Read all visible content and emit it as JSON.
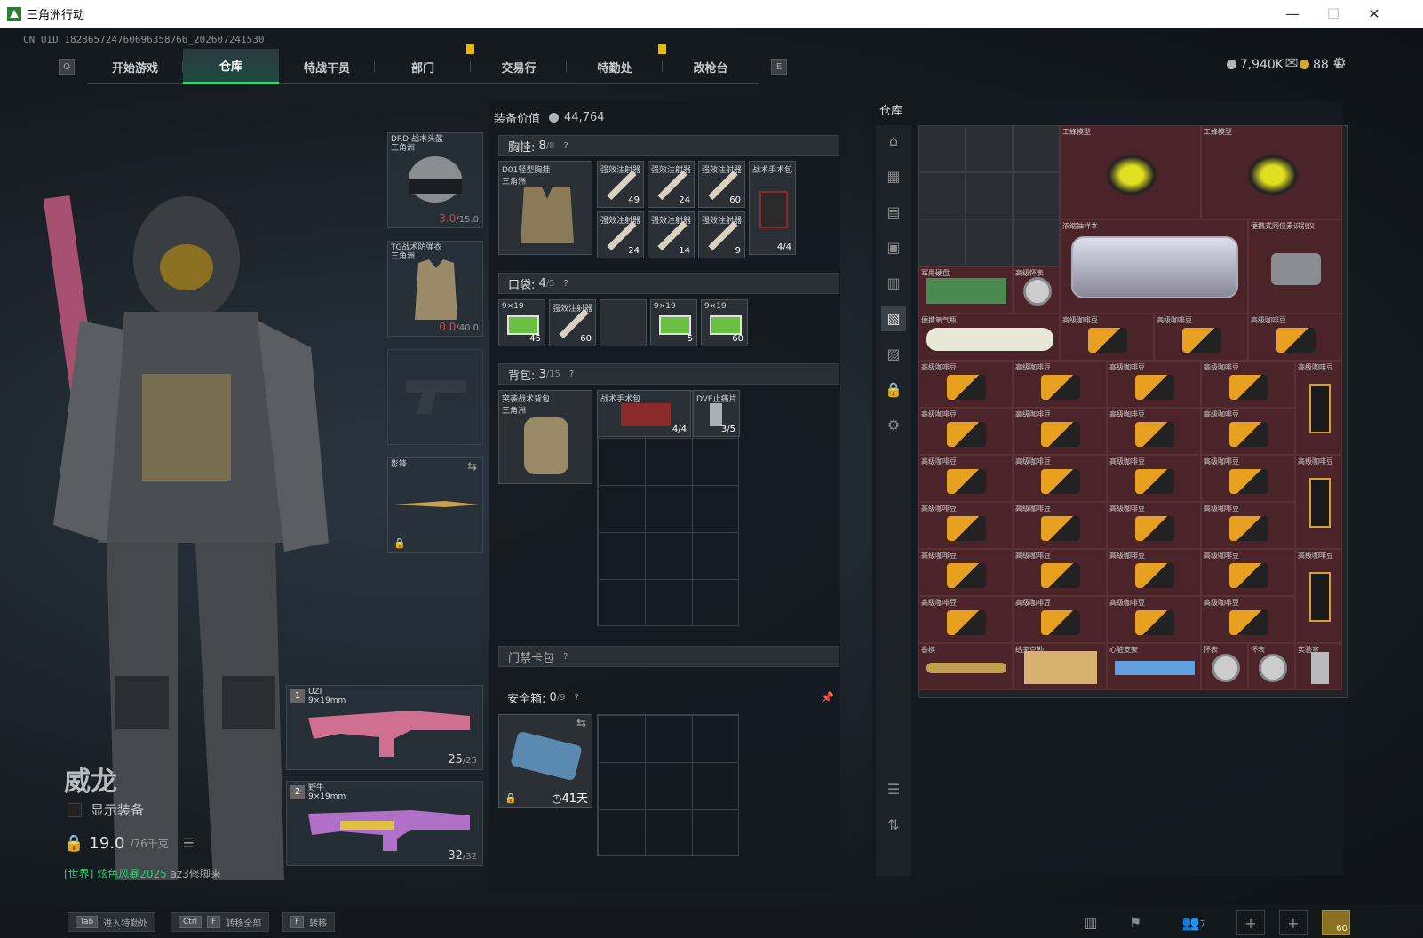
{
  "window": {
    "title": "三角洲行动",
    "minimize": "—",
    "maximize": "☐",
    "close": "✕"
  },
  "uid": "CN UID 18236572476069635876­6_202607241530",
  "nav": {
    "key_left": "Q",
    "key_right": "E",
    "tabs": [
      "开始游戏",
      "仓库",
      "特战干员",
      "部门",
      "交易行",
      "特勤处",
      "改枪台"
    ],
    "active": "仓库"
  },
  "currency": {
    "silver": "7,940K",
    "gold": "88",
    "plus": "+"
  },
  "operator": {
    "name": "威龙",
    "show_equipment": "显示装备",
    "weight": "19.0",
    "weight_max": "/76千克"
  },
  "chat": {
    "channel": "[世界]",
    "user": "炫色风暴2025",
    "message": "az3修脚来"
  },
  "gear": {
    "helmet": {
      "name": "DRD 战术头盔",
      "sub": "三角洲",
      "dur": "3.0",
      "max": "/15.0"
    },
    "armor": {
      "name": "TG战术防弹衣",
      "sub": "三角洲",
      "dur": "0.0",
      "max": "/40.0"
    },
    "melee": {
      "name": "影锋"
    }
  },
  "weapons": [
    {
      "num": "1",
      "name": "UZI",
      "sub": "9×19mm",
      "ammo": "25",
      "ammo_max": "/25"
    },
    {
      "num": "2",
      "name": "野牛",
      "sub": "9×19mm",
      "ammo": "32",
      "ammo_max": "/32"
    }
  ],
  "loadout": {
    "value_label": "装备价值",
    "value": "44,764",
    "chest": {
      "label": "胸挂:",
      "count": "8",
      "cap": "/8",
      "q": "?"
    },
    "chest_item": {
      "name": "D01轻型胸挂",
      "sub": "三角洲"
    },
    "chest_cells": [
      {
        "name": "强效注射器",
        "count": "49"
      },
      {
        "name": "强效注射器",
        "count": "24"
      },
      {
        "name": "强效注射器",
        "count": "60"
      },
      {
        "name": "战术手术包",
        "count": "4/4"
      },
      {
        "name": "强效注射器",
        "count": "24"
      },
      {
        "name": "强效注射器",
        "count": "14"
      },
      {
        "name": "强效注射器",
        "count": "9"
      }
    ],
    "pocket": {
      "label": "口袋:",
      "count": "4",
      "cap": "/5",
      "q": "?"
    },
    "pocket_cells": [
      {
        "name": "9×19",
        "count": "45"
      },
      {
        "name": "强效注射器",
        "count": "60"
      },
      {
        "name": "",
        "count": ""
      },
      {
        "name": "9×19",
        "count": "5"
      },
      {
        "name": "9×19",
        "count": "60"
      }
    ],
    "backpack": {
      "label": "背包:",
      "count": "3",
      "cap": "/15",
      "q": "?"
    },
    "backpack_item": {
      "name": "突袭战术背包",
      "sub": "三角洲"
    },
    "backpack_cells": [
      {
        "name": "战术手术包",
        "count": "4/4"
      },
      {
        "name": "DVE止痛片",
        "count": "3/5"
      }
    ],
    "keycard": {
      "label": "门禁卡包",
      "q": "?"
    },
    "safebox": {
      "label": "安全箱:",
      "count": "0",
      "cap": "/9",
      "q": "?",
      "days": "41天"
    }
  },
  "storage": {
    "label": "仓库",
    "items": [
      {
        "name": "工蜂模型"
      },
      {
        "name": "工蜂模型"
      },
      {
        "name": "浓缩铀样本"
      },
      {
        "name": "便携式同位素识别仪"
      },
      {
        "name": "军用硬盘"
      },
      {
        "name": "高级怀表"
      },
      {
        "name": "便携氧气瓶"
      },
      {
        "name": "高级咖啡豆"
      },
      {
        "name": "香槟"
      },
      {
        "name": "给夫克勒"
      },
      {
        "name": "心脏支架"
      },
      {
        "name": "怀表"
      },
      {
        "name": "怀表"
      },
      {
        "name": "实验室"
      }
    ],
    "coffee_label": "高级咖啡豆",
    "coffee_bag_label": "高级咖啡豆"
  },
  "bottom": {
    "hint1_key": "Tab",
    "hint1": "进入特勤处",
    "hint2_key1": "Ctrl",
    "hint2_key2": "F",
    "hint2": "转移全部",
    "hint3_key": "F",
    "hint3": "转移",
    "friends": "7",
    "avatar_level": "60"
  },
  "colors": {
    "accent": "#2ecc71",
    "valuable_cell": "#4a2428",
    "warn": "#e6b800",
    "damage": "#e04040"
  }
}
